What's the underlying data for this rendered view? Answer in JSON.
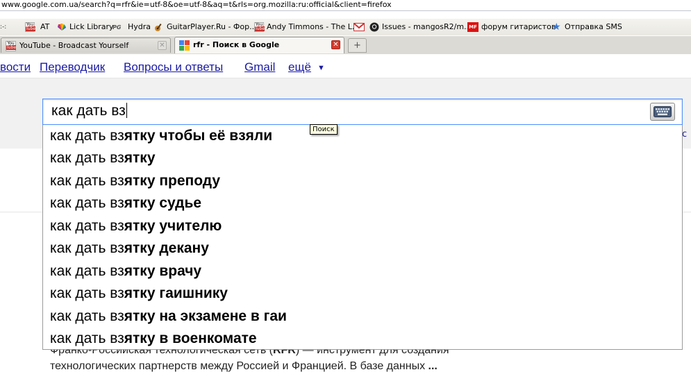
{
  "url": "www.google.com.ua/search?q=rfr&ie=utf-8&oe=utf-8&aq=t&rls=org.mozilla:ru:official&client=firefox",
  "bookmarks": [
    {
      "label": "",
      "icon": "bookmark-cut-icon"
    },
    {
      "label": "",
      "icon": "youtube-icon"
    },
    {
      "label": "AT",
      "icon": "at-icon"
    },
    {
      "label": "Lick Library",
      "icon": "nbc-peacock-icon"
    },
    {
      "label": "Hydra",
      "icon": "pg-icon"
    },
    {
      "label": "GuitarPlayer.Ru - Фор...",
      "icon": "guitar-icon"
    },
    {
      "label": "Andy Timmons - The L...",
      "icon": "youtube-icon"
    },
    {
      "label": "",
      "icon": "gmail-icon"
    },
    {
      "label": "Issues - mangosR2/m...",
      "icon": "github-icon"
    },
    {
      "label": "форум гитаристов",
      "icon": "mf-icon"
    },
    {
      "label": "Отправка SMS",
      "icon": "star-icon"
    }
  ],
  "tabs": [
    {
      "title": "YouTube - Broadcast Yourself",
      "active": false
    },
    {
      "title": "rfr - Поиск в Google",
      "active": true
    }
  ],
  "google_nav": {
    "items": [
      "вости",
      "Переводчик",
      "Вопросы и ответы",
      "Gmail",
      "ещё"
    ],
    "more_arrow": "▼"
  },
  "search": {
    "value": "как дать вз",
    "keyboard_icon": "keyboard-icon",
    "tooltip": "Поиск",
    "right_stub": "c"
  },
  "suggestions": [
    {
      "typed": "как дать вз",
      "completion": "ятку чтобы её взяли"
    },
    {
      "typed": "как дать вз",
      "completion": "ятку"
    },
    {
      "typed": "как дать вз",
      "completion": "ятку преподу"
    },
    {
      "typed": "как дать вз",
      "completion": "ятку судье"
    },
    {
      "typed": "как дать вз",
      "completion": "ятку учителю"
    },
    {
      "typed": "как дать вз",
      "completion": "ятку декану"
    },
    {
      "typed": "как дать вз",
      "completion": "ятку врачу"
    },
    {
      "typed": "как дать вз",
      "completion": "ятку гаишнику"
    },
    {
      "typed": "как дать вз",
      "completion": "ятку на экзамене в гаи"
    },
    {
      "typed": "как дать вз",
      "completion": "ятку в военкомате"
    }
  ],
  "results": {
    "line1_a": "Франко-Российская технологическая сеть (",
    "line1_b": "RFR",
    "line1_c": ") — инструмент для создания",
    "line2_a": "технологических партнерств между Россией и Францией. В базе данных ",
    "line2_b": "..."
  }
}
